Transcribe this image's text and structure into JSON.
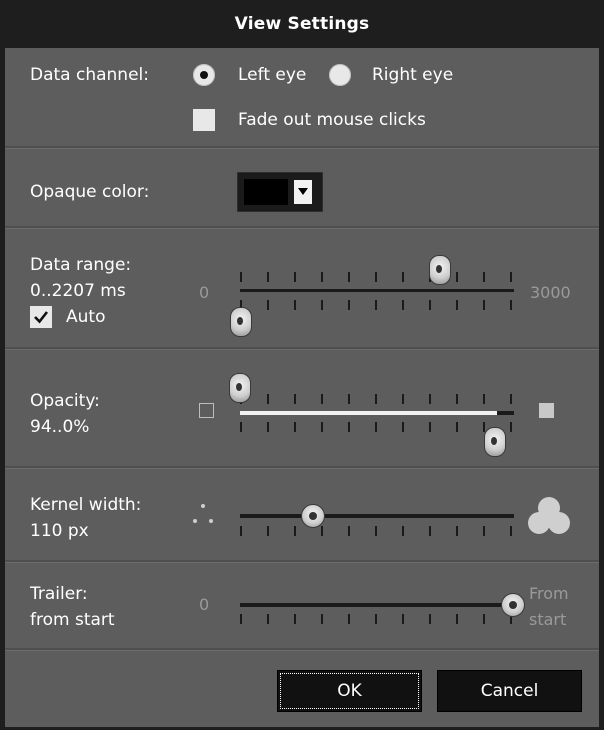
{
  "window": {
    "title": "View Settings"
  },
  "data_channel": {
    "label": "Data channel:",
    "options": [
      {
        "label": "Left eye",
        "selected": true
      },
      {
        "label": "Right eye",
        "selected": false
      }
    ],
    "fade_out": {
      "label": "Fade out mouse clicks",
      "checked": false
    }
  },
  "opaque_color": {
    "label": "Opaque color:",
    "value": "#000000"
  },
  "data_range": {
    "label": "Data range:",
    "value_text": "0..2207 ms",
    "auto_label": "Auto",
    "auto_checked": true,
    "min_label": "0",
    "max_label": "3000",
    "low": 0,
    "high": 2207
  },
  "opacity": {
    "label": "Opacity:",
    "value_text": "94..0%",
    "low_percent": 0,
    "high_percent": 94
  },
  "kernel_width": {
    "label": "Kernel width:",
    "value_text": "110 px"
  },
  "trailer": {
    "label": "Trailer:",
    "value_text": "from start",
    "min_label": "0",
    "max_label_1": "From",
    "max_label_2": "start"
  },
  "buttons": {
    "ok": "OK",
    "cancel": "Cancel"
  }
}
